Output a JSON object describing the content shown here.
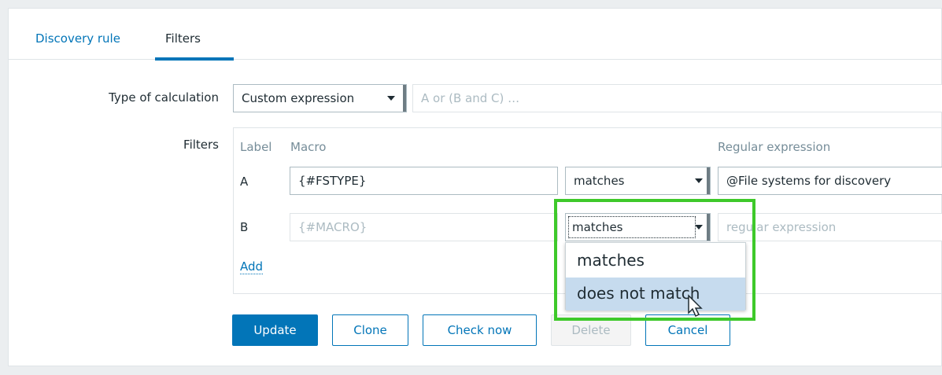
{
  "tabs": [
    {
      "label": "Discovery rule"
    },
    {
      "label": "Filters"
    }
  ],
  "form": {
    "type_of_calculation_label": "Type of calculation",
    "type_of_calculation_value": "Custom expression",
    "formula_placeholder": "A or (B and C) …",
    "filters_label": "Filters"
  },
  "filters_table": {
    "headers": {
      "label": "Label",
      "macro": "Macro",
      "regex": "Regular expression"
    },
    "rows": [
      {
        "label": "A",
        "macro": "{#FSTYPE}",
        "operator": "matches",
        "regex": "@File systems for discovery"
      },
      {
        "label": "B",
        "macro_placeholder": "{#MACRO}",
        "operator": "matches",
        "regex_placeholder": "regular expression"
      }
    ],
    "add_label": "Add"
  },
  "dropdown": {
    "options": [
      "matches",
      "does not match"
    ],
    "hovered": "does not match"
  },
  "buttons": {
    "update": "Update",
    "clone": "Clone",
    "check_now": "Check now",
    "delete": "Delete",
    "cancel": "Cancel"
  },
  "colors": {
    "accent": "#0275b8",
    "highlight": "#3ec92a",
    "hover": "#c6dbee"
  }
}
